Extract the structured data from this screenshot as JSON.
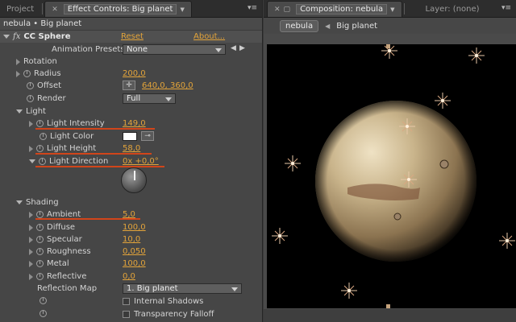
{
  "left_panel": {
    "tabs": {
      "project": "Project",
      "effect_controls": "Effect Controls: Big planet"
    },
    "breadcrumb": "nebula • Big planet",
    "effect": {
      "fx_mark": "fx",
      "name": "CC Sphere",
      "reset": "Reset",
      "about": "About..."
    },
    "presets": {
      "label": "Animation Presets:",
      "value": "None"
    },
    "rotation": {
      "label": "Rotation"
    },
    "radius": {
      "label": "Radius",
      "value": "200,0"
    },
    "offset": {
      "label": "Offset",
      "value": "640,0, 360,0"
    },
    "render": {
      "label": "Render",
      "value": "Full"
    },
    "light": {
      "label": "Light"
    },
    "light_intensity": {
      "label": "Light Intensity",
      "value": "149,0"
    },
    "light_color": {
      "label": "Light Color",
      "value": "#ffffff"
    },
    "light_height": {
      "label": "Light Height",
      "value": "58,0"
    },
    "light_direction": {
      "label": "Light Direction",
      "value": "0x +0,0°"
    },
    "shading": {
      "label": "Shading"
    },
    "ambient": {
      "label": "Ambient",
      "value": "5,0"
    },
    "diffuse": {
      "label": "Diffuse",
      "value": "100,0"
    },
    "specular": {
      "label": "Specular",
      "value": "10,0"
    },
    "roughness": {
      "label": "Roughness",
      "value": "0,050"
    },
    "metal": {
      "label": "Metal",
      "value": "100,0"
    },
    "reflective": {
      "label": "Reflective",
      "value": "0,0"
    },
    "reflection_map": {
      "label": "Reflection Map",
      "value": "1. Big planet"
    },
    "internal_shadows": {
      "label": "Internal Shadows",
      "checked": false
    },
    "transparency_falloff": {
      "label": "Transparency Falloff",
      "checked": false
    }
  },
  "right_panel": {
    "tabs": {
      "composition": "Composition: nebula",
      "layer": "Layer: (none)"
    },
    "nav": {
      "comp": "nebula",
      "layer": "Big planet"
    }
  },
  "colors": {
    "accent_value": "#e3a43a",
    "annotation_underline": "#d1451a",
    "viewer_background": "#000000",
    "star": "#e8c8a8"
  },
  "icons": [
    "close-icon",
    "dropdown-arrow-icon",
    "panel-menu-icon",
    "stopwatch-icon",
    "crosshair-icon",
    "eyedropper-icon",
    "angle-dial-icon",
    "twirl-arrow-icon",
    "lock-icon"
  ]
}
